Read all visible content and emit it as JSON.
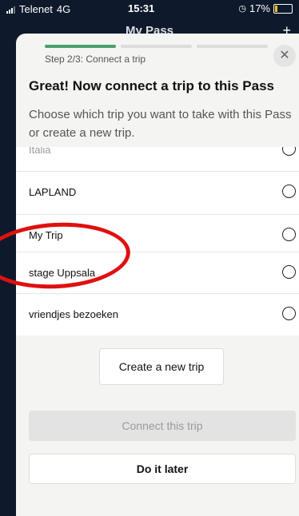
{
  "status_bar": {
    "carrier": "Telenet",
    "network": "4G",
    "time": "15:31",
    "battery": "17%"
  },
  "background": {
    "title": "My Pass",
    "add_icon": "plus-icon"
  },
  "sheet": {
    "step_label": "Step 2/3: Connect a trip",
    "progress": {
      "current_step": 2,
      "total_steps": 3
    },
    "headline": "Great! Now connect a trip to this Pass",
    "subtitle": "Choose which trip you want to take with this Pass or create a new trip.",
    "close_icon": "close-icon"
  },
  "trips": [
    {
      "label": "Italia",
      "selected": false
    },
    {
      "label": "LAPLAND",
      "selected": false
    },
    {
      "label": "My Trip",
      "selected": false
    },
    {
      "label": "stage Uppsala",
      "selected": false
    },
    {
      "label": "vriendjes bezoeken",
      "selected": false
    }
  ],
  "buttons": {
    "create": "Create a new trip",
    "connect": "Connect this trip",
    "later": "Do it later"
  },
  "colors": {
    "accent": "#4aa06a",
    "annotation": "#e01010"
  }
}
